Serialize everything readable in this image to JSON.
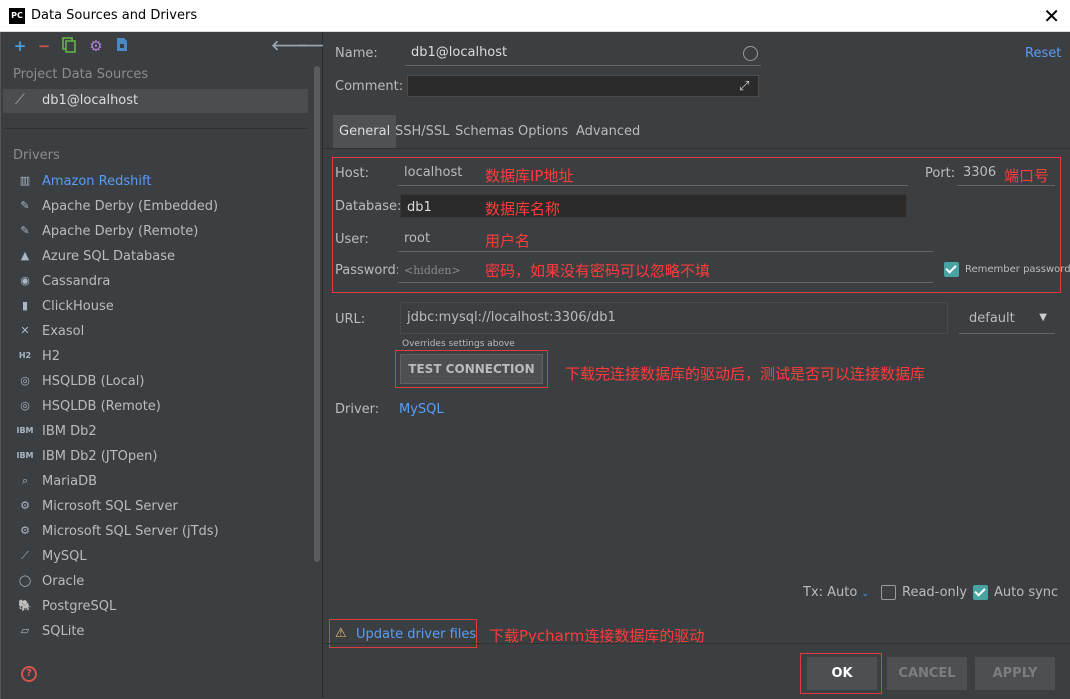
{
  "window": {
    "title": "Data Sources and Drivers",
    "app_icon": "PC",
    "close": "✕"
  },
  "left": {
    "project_header": "Project Data Sources",
    "project_item": "db1@localhost",
    "drivers_header": "Drivers",
    "drivers": [
      {
        "label": "Amazon Redshift",
        "icon": "▥",
        "active": true
      },
      {
        "label": "Apache Derby (Embedded)",
        "icon": "✎",
        "active": false
      },
      {
        "label": "Apache Derby (Remote)",
        "icon": "✎",
        "active": false
      },
      {
        "label": "Azure SQL Database",
        "icon": "▲",
        "active": false
      },
      {
        "label": "Cassandra",
        "icon": "◉",
        "active": false
      },
      {
        "label": "ClickHouse",
        "icon": "▮",
        "active": false
      },
      {
        "label": "Exasol",
        "icon": "✕",
        "active": false
      },
      {
        "label": "H2",
        "icon": "H2",
        "active": false
      },
      {
        "label": "HSQLDB (Local)",
        "icon": "◎",
        "active": false
      },
      {
        "label": "HSQLDB (Remote)",
        "icon": "◎",
        "active": false
      },
      {
        "label": "IBM Db2",
        "icon": "IBM",
        "active": false
      },
      {
        "label": "IBM Db2 (JTOpen)",
        "icon": "IBM",
        "active": false
      },
      {
        "label": "MariaDB",
        "icon": "⌕",
        "active": false
      },
      {
        "label": "Microsoft SQL Server",
        "icon": "⚙",
        "active": false
      },
      {
        "label": "Microsoft SQL Server (jTds)",
        "icon": "⚙",
        "active": false
      },
      {
        "label": "MySQL",
        "icon": "⟋",
        "active": false
      },
      {
        "label": "Oracle",
        "icon": "◯",
        "active": false
      },
      {
        "label": "PostgreSQL",
        "icon": "🐘",
        "active": false
      },
      {
        "label": "SQLite",
        "icon": "▱",
        "active": false
      }
    ]
  },
  "form": {
    "name_label": "Name:",
    "name_value": "db1@localhost",
    "reset": "Reset",
    "comment_label": "Comment:",
    "tabs": [
      "General",
      "SSH/SSL",
      "Schemas",
      "Options",
      "Advanced"
    ],
    "host_label": "Host:",
    "host_value": "localhost",
    "port_label": "Port:",
    "port_value": "3306",
    "database_label": "Database:",
    "database_value": "db1",
    "user_label": "User:",
    "user_value": "root",
    "password_label": "Password:",
    "password_placeholder": "<hidden>",
    "remember_password": "Remember password",
    "url_label": "URL:",
    "url_value": "jdbc:mysql://localhost:3306/db1",
    "url_mode": "default",
    "overrides_note": "Overrides settings above",
    "test_connection": "TEST CONNECTION",
    "driver_label": "Driver:",
    "driver_value": "MySQL",
    "tx_label": "Tx: Auto",
    "read_only": "Read-only",
    "auto_sync": "Auto sync",
    "update_driver": "Update driver files"
  },
  "annotations": {
    "host": "数据库IP地址",
    "port": "端口号",
    "database": "数据库名称",
    "user": "用户名",
    "password": "密码，如果没有密码可以忽略不填",
    "test": "下载完连接数据库的驱动后，测试是否可以连接数据库",
    "update": "下载Pycharm连接数据库的驱动"
  },
  "buttons": {
    "ok": "OK",
    "cancel": "CANCEL",
    "apply": "APPLY"
  },
  "colors": {
    "accent": "#589df6",
    "annotation": "#ff3b3b",
    "panel": "#3c3f41"
  }
}
